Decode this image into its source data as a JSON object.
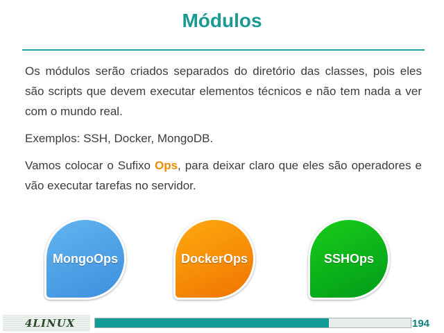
{
  "slide": {
    "title": "Módulos",
    "paragraph1": "Os módulos serão criados separados do diretório das classes, pois eles são scripts que devem executar elementos técnicos e não tem nada a ver com o mundo real.",
    "paragraph2": "Exemplos: SSH, Docker, MongoDB.",
    "paragraph3_before": "Vamos colocar o Sufixo ",
    "paragraph3_highlight": "Ops",
    "paragraph3_after": ", para deixar claro que eles são operadores e vão executar tarefas no servidor."
  },
  "badges": [
    {
      "label": "MongoOps",
      "color": "#4a9ee6"
    },
    {
      "label": "DockerOps",
      "color": "#f78d00"
    },
    {
      "label": "SSHOps",
      "color": "#0fb81a"
    }
  ],
  "footer": {
    "logo_text": "4LINUX",
    "page_number": "194",
    "progress_fraction": 0.74
  },
  "colors": {
    "title": "#1b9a94",
    "accent_highlight": "#f08a00",
    "progress": "#139c97"
  }
}
